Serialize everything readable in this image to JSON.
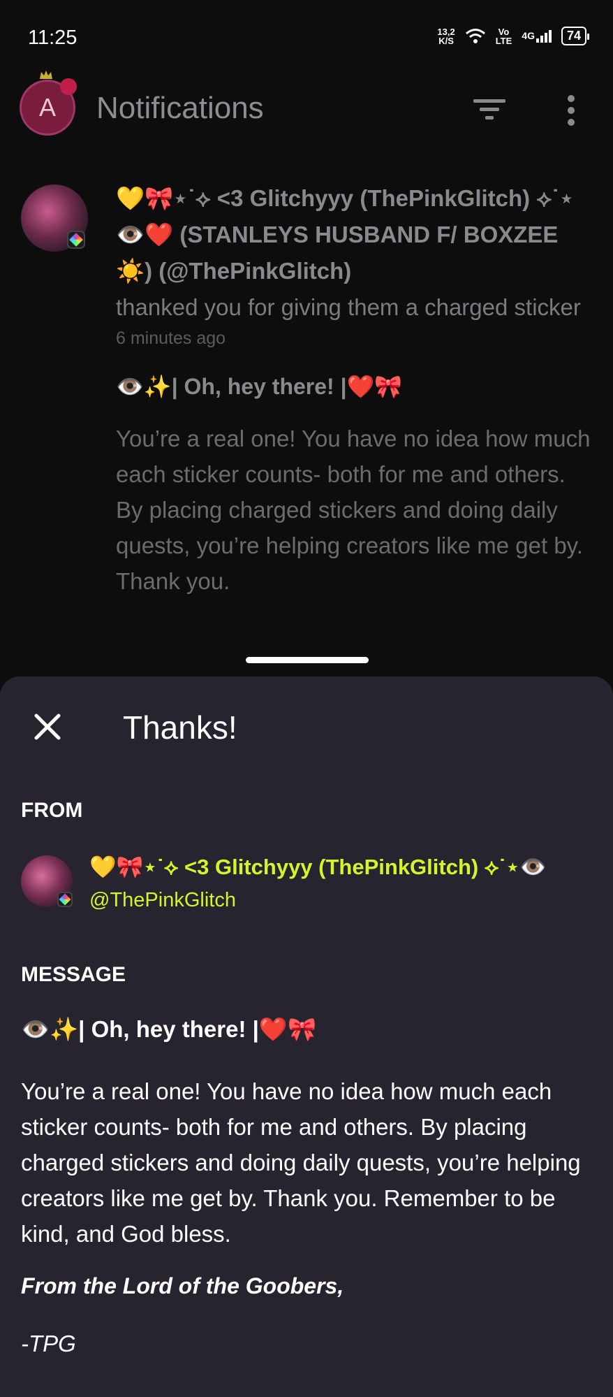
{
  "status_bar": {
    "time": "11:25",
    "net_speed_value": "13,2",
    "net_speed_unit": "K/S",
    "volte_top": "Vo",
    "volte_bottom": "LTE",
    "network": "4G",
    "battery": "74"
  },
  "header": {
    "avatar_letter": "A",
    "title": "Notifications"
  },
  "notification": {
    "sender_name": "💛🎀⋆˙⟡ <3 Glitchyyy (ThePinkGlitch) ⟡˙⋆👁️❤️ (STANLEYS HUSBAND F/ BOXZEE ☀️) (@ThePinkGlitch)",
    "action_text": "thanked you for giving them a charged sticker",
    "time_ago": "6 minutes ago",
    "message_title": "👁️✨| Oh, hey there! |❤️🎀",
    "message_preview": "You’re a real one! You have no idea how much each sticker counts- both for me and others. By placing charged stickers and doing daily quests, you’re helping creators like me get by. Thank you."
  },
  "sheet": {
    "title": "Thanks!",
    "from_label": "FROM",
    "from_name": "💛🎀⋆˙⟡ <3 Glitchyyy (ThePinkGlitch) ⟡˙⋆👁️",
    "from_handle": "@ThePinkGlitch",
    "message_label": "MESSAGE",
    "message_title": "👁️✨| Oh, hey there! |❤️🎀",
    "message_body": "You’re a real one! You have no idea how much each sticker counts- both for me and others. By placing charged stickers and doing daily quests, you’re helping creators like me get by. Thank you. Remember to be kind, and God bless.",
    "signature": "From the Lord of the Goobers,",
    "signoff": "-TPG"
  },
  "colors": {
    "background": "#0d0d0e",
    "sheet": "#27242f",
    "accent": "#d4f52b"
  },
  "icons": [
    "wifi-icon",
    "signal-icon",
    "battery-icon",
    "filter-icon",
    "more-vert-icon",
    "close-icon"
  ]
}
